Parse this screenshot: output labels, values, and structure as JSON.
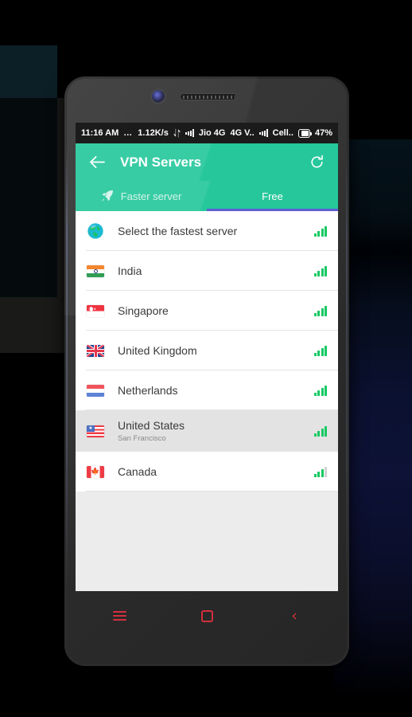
{
  "status_bar": {
    "time": "11:16 AM",
    "dots": "…",
    "network_speed": "1.12K/s",
    "data_arrows_icon": "data-transfer-icon",
    "sim1_signal_icon": "signal-bars-icon",
    "carrier1": "Jio 4G",
    "network_type": "4G V..",
    "sim2_signal_icon": "signal-bars-icon",
    "carrier2": "Cell..",
    "battery_icon": "battery-icon",
    "battery_percent": "47%"
  },
  "app_bar": {
    "back_icon": "back-arrow-icon",
    "title": "VPN Servers",
    "refresh_icon": "refresh-icon",
    "accent_color": "#25c79b"
  },
  "tabs": {
    "indicator_color": "#5c5fd6",
    "items": [
      {
        "label": "Faster server",
        "icon": "rocket-icon",
        "active": false
      },
      {
        "label": "Free",
        "icon": "",
        "active": true
      }
    ]
  },
  "server_list": {
    "rows": [
      {
        "name": "Select the fastest server",
        "subtitle": "",
        "flag": "globe-icon",
        "signal": 4,
        "selected": false
      },
      {
        "name": "India",
        "subtitle": "",
        "flag": "flag-india-icon",
        "signal": 4,
        "selected": false
      },
      {
        "name": "Singapore",
        "subtitle": "",
        "flag": "flag-singapore-icon",
        "signal": 4,
        "selected": false
      },
      {
        "name": "United Kingdom",
        "subtitle": "",
        "flag": "flag-united-kingdom-icon",
        "signal": 4,
        "selected": false
      },
      {
        "name": "Netherlands",
        "subtitle": "",
        "flag": "flag-netherlands-icon",
        "signal": 4,
        "selected": false
      },
      {
        "name": "United States",
        "subtitle": "San Francisco",
        "flag": "flag-united-states-icon",
        "signal": 4,
        "selected": true
      },
      {
        "name": "Canada",
        "subtitle": "",
        "flag": "flag-canada-icon",
        "signal": 3,
        "selected": false
      }
    ]
  },
  "nav_bar": {
    "menu_icon": "menu-icon",
    "home_icon": "home-icon",
    "back_icon": "back-chevron-icon",
    "color": "#d3303c"
  }
}
